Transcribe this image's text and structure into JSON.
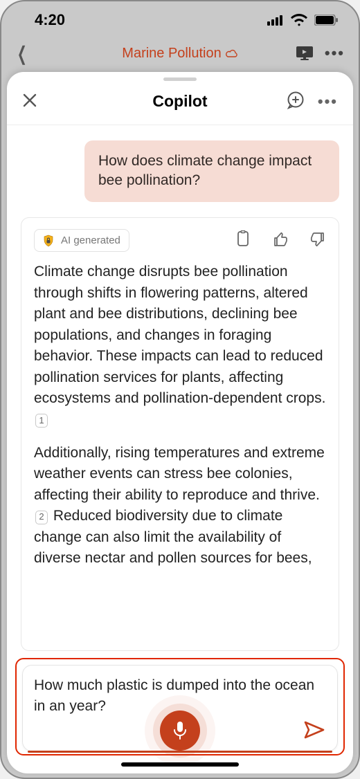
{
  "status": {
    "time": "4:20"
  },
  "background_app": {
    "title": "Marine Pollution"
  },
  "sheet": {
    "title": "Copilot",
    "user_message": "How does climate change impact bee pollination?",
    "ai": {
      "badge": "AI generated",
      "paragraph1_a": "Climate change disrupts bee pollination through shifts in flowering patterns, altered plant and bee distributions, declining bee populations, and changes in foraging behavior. These impacts can lead to reduced pollination services for plants, affecting ecosystems and pollination-dependent crops.",
      "cite1": "1",
      "paragraph2_a": "Additionally, rising temperatures and extreme weather events can stress bee colonies, affecting their ability to reproduce and thrive.",
      "cite2": "2",
      "paragraph2_b": " Reduced biodiversity due to climate change can also limit the availability of diverse nectar and pollen sources for bees,"
    },
    "input_text": "How much plastic is dumped into the ocean in an year?"
  }
}
